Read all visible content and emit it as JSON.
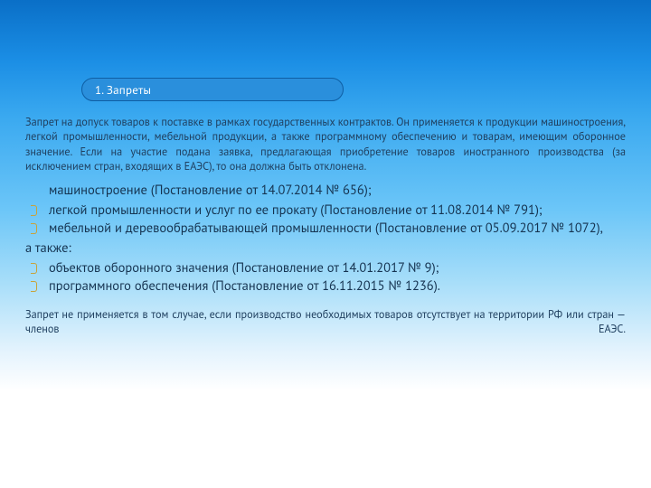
{
  "header": {
    "tag": "1. Запреты"
  },
  "body": {
    "intro": "Запрет на допуск товаров к поставке в рамках государственных контрактов. Он применяется к продукции машиностроения, легкой промышленности, мебельной продукции, а также программному обеспечению и товарам, имеющим оборонное значение. Если на участие подана заявка, предлагающая приобретение товаров иностранного производства (за исключением стран, входящих в ЕАЭС), то она должна быть отклонена.",
    "line_machinery": "машиностроение (Постановление от 14.07.2014 № 656);",
    "list1": [
      " легкой промышленности и услуг по ее прокату (Постановление от 11.08.2014 № 791);",
      "мебельной и деревообрабатывающей промышленности (Постановление от 05.09.2017 № 1072),"
    ],
    "also": "а также:",
    "list2": [
      "объектов оборонного значения (Постановление от 14.01.2017 № 9);",
      " программного обеспечения (Постановление от 16.11.2015 № 1236)."
    ],
    "outro": "Запрет не применяется в том случае, если производство необходимых товаров отсутствует на территории РФ или стран — членов ЕАЭС."
  }
}
